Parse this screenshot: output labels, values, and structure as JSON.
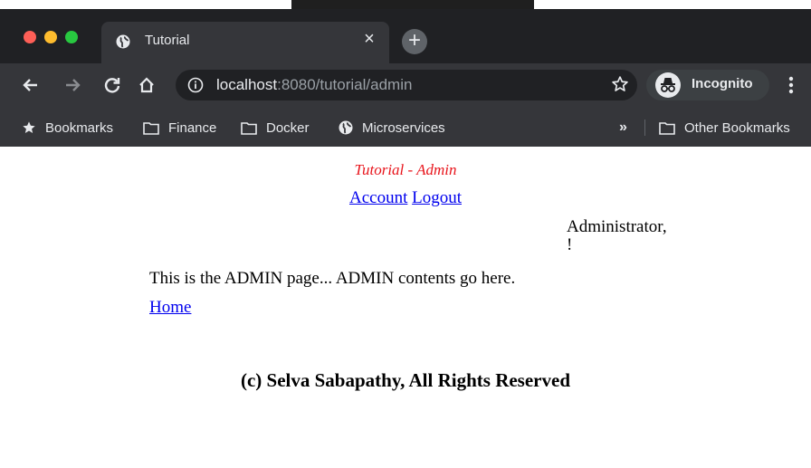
{
  "browser": {
    "tab_title": "Tutorial",
    "tab_close": "×",
    "new_tab": "+",
    "url_host": "localhost",
    "url_rest": ":8080/tutorial/admin",
    "incognito_label": "Incognito",
    "bookmarks": {
      "star_label": "Bookmarks",
      "finance": "Finance",
      "docker": "Docker",
      "microservices": "Microservices",
      "overflow": "»",
      "other": "Other Bookmarks"
    }
  },
  "page": {
    "title": "Tutorial - Admin",
    "account_link": "Account",
    "logout_link": "Logout",
    "admin_line1": "Administrator,",
    "admin_line2": "!",
    "content": "This is the ADMIN page... ADMIN contents go here.",
    "home_link": "Home",
    "footer": "(c) Selva Sabapathy, All Rights Reserved"
  },
  "colors": {
    "chrome_dark": "#202124",
    "toolbar": "#35363a",
    "title_red": "#e8141b",
    "link_blue": "#0000ee"
  }
}
